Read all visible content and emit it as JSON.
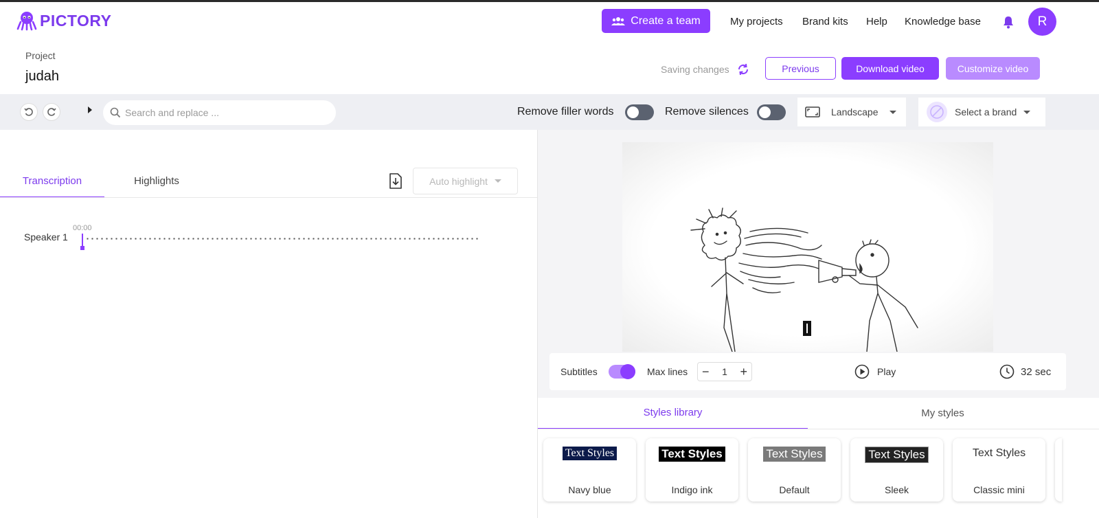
{
  "app": {
    "brand": "PICTORY",
    "accent": "#8b3dff"
  },
  "header": {
    "create_team": "Create a team",
    "nav": [
      "My projects",
      "Brand kits",
      "Help",
      "Knowledge base"
    ],
    "avatar_initial": "R"
  },
  "project": {
    "label": "Project",
    "name": "judah",
    "saving_status": "Saving changes",
    "previous": "Previous",
    "download": "Download video",
    "customize": "Customize video"
  },
  "toolbar": {
    "search_placeholder": "Search and replace ...",
    "remove_filler": "Remove filler words",
    "remove_silences": "Remove silences",
    "aspect": "Landscape",
    "brand_select": "Select a brand"
  },
  "transcript": {
    "tabs": [
      "Transcription",
      "Highlights"
    ],
    "auto_highlight": "Auto highlight",
    "speaker": "Speaker 1",
    "timestamp": "00:00"
  },
  "player": {
    "subtitles": "Subtitles",
    "subtitles_on": true,
    "max_lines_label": "Max lines",
    "max_lines": "1",
    "play": "Play",
    "duration": "32 sec"
  },
  "styles": {
    "tabs": [
      "Styles library",
      "My styles"
    ],
    "cards": [
      {
        "preview": "Text Styles",
        "name": "Navy blue"
      },
      {
        "preview": "Text Styles",
        "name": "Indigo ink"
      },
      {
        "preview": "Text Styles",
        "name": "Default"
      },
      {
        "preview": "Text Styles",
        "name": "Sleek"
      },
      {
        "preview": "Text Styles",
        "name": "Classic mini"
      }
    ]
  }
}
